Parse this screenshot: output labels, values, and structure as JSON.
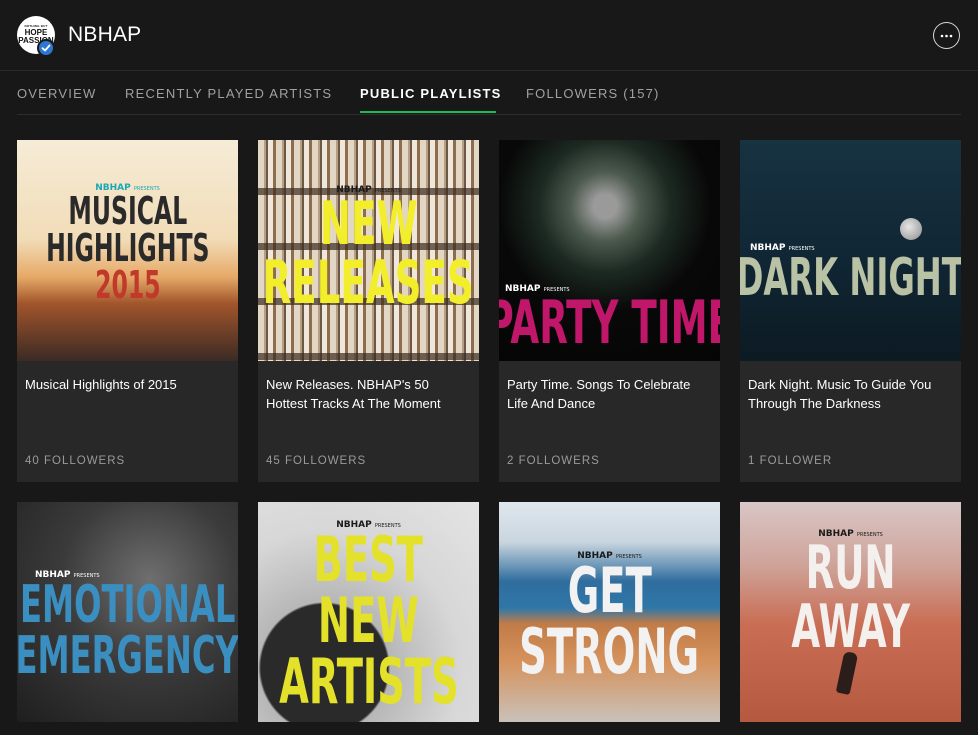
{
  "profile": {
    "name": "NBHAP",
    "avatar_lines": [
      "NOTHING BUT",
      "HOPE",
      "PASSION"
    ],
    "more_icon": "ellipsis-icon"
  },
  "tabs": [
    {
      "label": "OVERVIEW",
      "active": false
    },
    {
      "label": "RECENTLY PLAYED ARTISTS",
      "active": false
    },
    {
      "label": "PUBLIC PLAYLISTS",
      "active": true
    },
    {
      "label": "FOLLOWERS (157)",
      "active": false
    }
  ],
  "accent_color": "#1db954",
  "playlists": [
    {
      "title": "Musical Highlights of 2015",
      "followers": "40 FOLLOWERS",
      "cover": {
        "brand": "NBHAP",
        "brand_small": "PRESENTS",
        "lines": [
          "MUSICAL",
          "HIGHLIGHTS"
        ],
        "accent_line": "2015",
        "brand_color": "#1aa7b8",
        "text_color": "#2a2a2a",
        "accent_color": "#c0392b"
      }
    },
    {
      "title": "New Releases. NBHAP's 50 Hottest Tracks At The Moment",
      "followers": "45 FOLLOWERS",
      "cover": {
        "brand": "NBHAP",
        "brand_small": "PRESENTS",
        "lines": [
          "NEW",
          "RELEASES"
        ],
        "brand_color": "#1a1a1a",
        "text_color": "#f2ee2b"
      }
    },
    {
      "title": "Party Time. Songs To Celebrate Life And Dance",
      "followers": "2 FOLLOWERS",
      "cover": {
        "brand": "NBHAP",
        "brand_small": "PRESENTS",
        "lines": [
          "PARTY TIME"
        ],
        "brand_color": "#ffffff",
        "text_color": "#c0176a"
      }
    },
    {
      "title": "Dark Night. Music To Guide You Through The Darkness",
      "followers": "1 FOLLOWER",
      "cover": {
        "brand": "NBHAP",
        "brand_small": "PRESENTS",
        "lines": [
          "DARK NIGHT"
        ],
        "brand_color": "#ffffff",
        "text_color": "#b9c2a4"
      }
    },
    {
      "title": "",
      "followers": "",
      "cover": {
        "brand": "NBHAP",
        "brand_small": "PRESENTS",
        "lines": [
          "EMOTIONAL",
          "EMERGENCY"
        ],
        "brand_color": "#ffffff",
        "text_color": "#3b8fc0"
      }
    },
    {
      "title": "",
      "followers": "",
      "cover": {
        "brand": "NBHAP",
        "brand_small": "PRESENTS",
        "lines": [
          "BEST",
          "NEW",
          "ARTISTS"
        ],
        "brand_color": "#1a1a1a",
        "text_color": "#e4e12a"
      }
    },
    {
      "title": "",
      "followers": "",
      "cover": {
        "brand": "NBHAP",
        "brand_small": "PRESENTS",
        "lines": [
          "GET",
          "STRONG"
        ],
        "brand_color": "#1a1a1a",
        "text_color": "#f2f2f2"
      }
    },
    {
      "title": "",
      "followers": "",
      "cover": {
        "brand": "NBHAP",
        "brand_small": "PRESENTS",
        "lines": [
          "RUN",
          "AWAY"
        ],
        "brand_color": "#1a1a1a",
        "text_color": "#f4f0ee"
      }
    }
  ]
}
